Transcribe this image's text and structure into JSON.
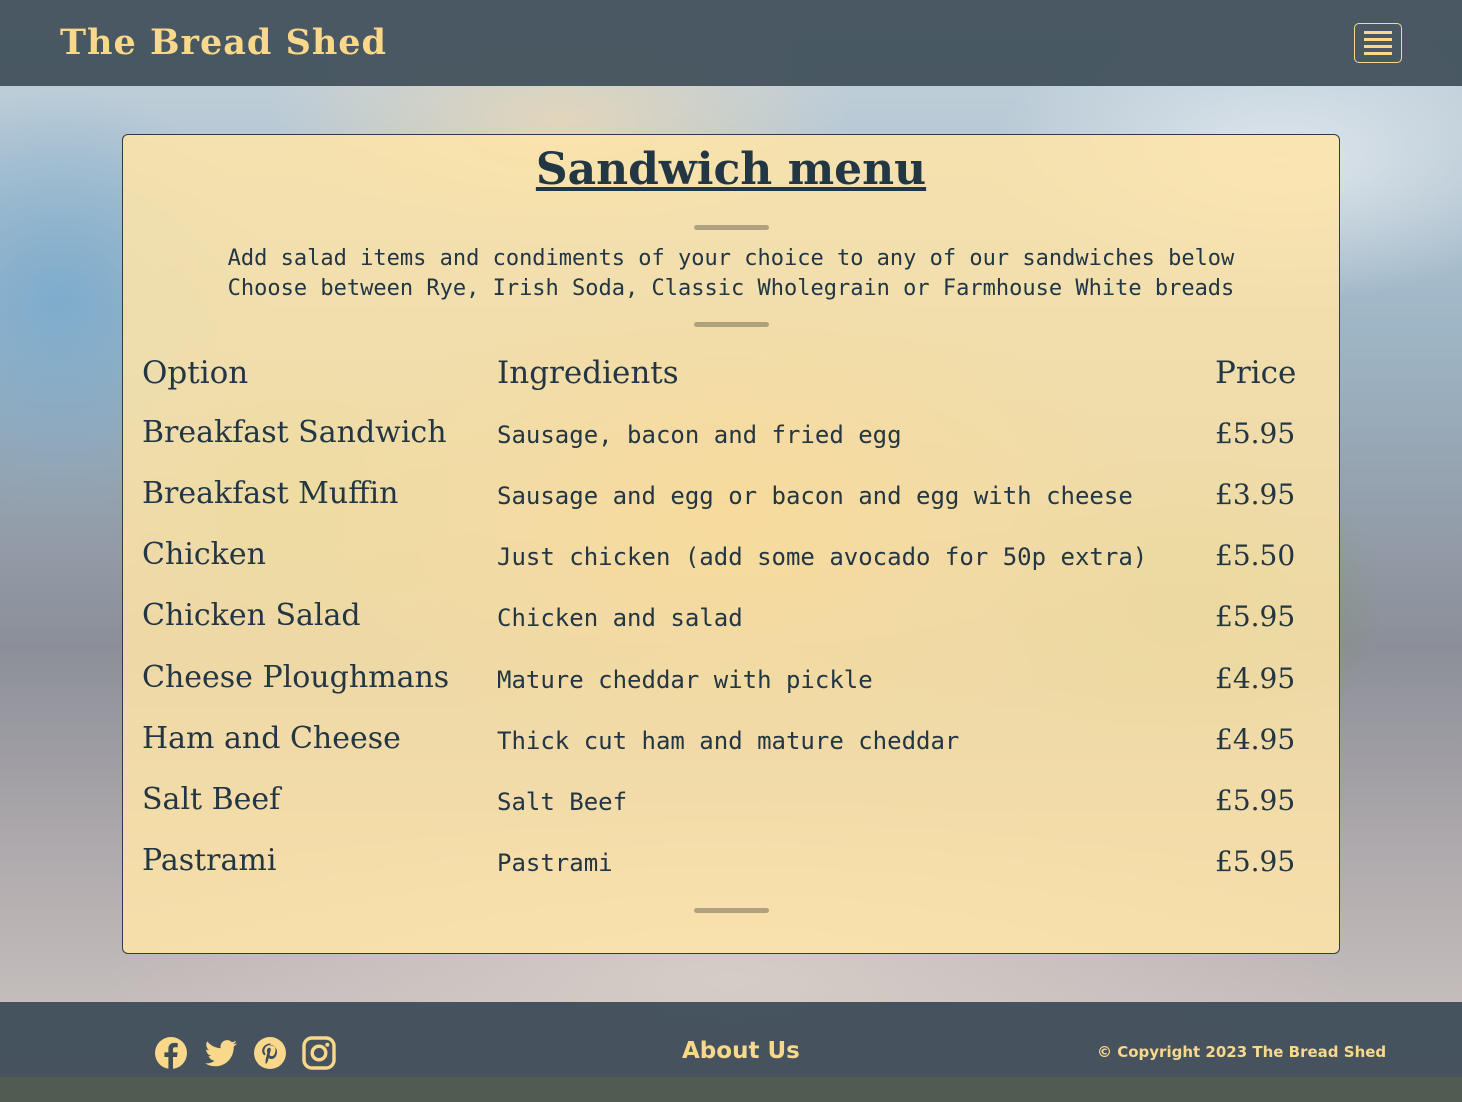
{
  "header": {
    "brand": "The Bread Shed",
    "menu_icon": "hamburger-menu-icon"
  },
  "menu": {
    "title": "Sandwich menu",
    "intro_line1": "Add salad items and condiments of your choice to any of our sandwiches below",
    "intro_line2": "Choose between Rye, Irish Soda, Classic Wholegrain or Farmhouse White breads",
    "columns": {
      "option": "Option",
      "ingredients": "Ingredients",
      "price": "Price"
    },
    "items": [
      {
        "option": "Breakfast Sandwich",
        "ingredients": "Sausage, bacon and fried egg",
        "price": "£5.95"
      },
      {
        "option": "Breakfast Muffin",
        "ingredients": "Sausage and egg or bacon and egg with cheese",
        "price": "£3.95"
      },
      {
        "option": "Chicken",
        "ingredients": "Just chicken (add some avocado for 50p extra)",
        "price": "£5.50"
      },
      {
        "option": "Chicken Salad",
        "ingredients": "Chicken and salad",
        "price": "£5.95"
      },
      {
        "option": "Cheese Ploughmans",
        "ingredients": "Mature cheddar with pickle",
        "price": "£4.95"
      },
      {
        "option": "Ham and Cheese",
        "ingredients": "Thick cut ham and mature cheddar",
        "price": "£4.95"
      },
      {
        "option": "Salt Beef",
        "ingredients": "Salt Beef",
        "price": "£5.95"
      },
      {
        "option": "Pastrami",
        "ingredients": "Pastrami",
        "price": "£5.95"
      }
    ]
  },
  "footer": {
    "social_icons": [
      "facebook-icon",
      "twitter-icon",
      "pinterest-icon",
      "instagram-icon"
    ],
    "about_label": "About Us",
    "copyright": "© Copyright 2023 The Bread Shed"
  },
  "colors": {
    "accent": "#f9d88b",
    "header_bg": "#3e4d58",
    "card_bg": "#ffe5a8",
    "text_dark": "#223644"
  }
}
